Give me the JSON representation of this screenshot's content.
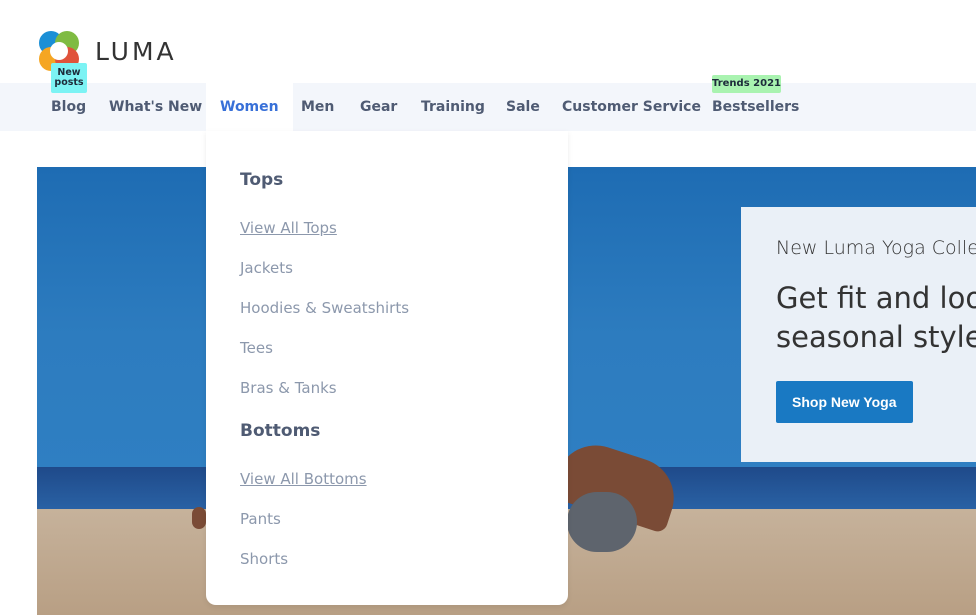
{
  "brand": {
    "name": "LUMA"
  },
  "colors": {
    "nav_bg": "#f3f6fb",
    "accent": "#3870d8",
    "button": "#1979c3",
    "badge_new": "#7cf3f4",
    "badge_trends": "#a9f3b0"
  },
  "nav": {
    "items": [
      {
        "label": "Blog",
        "active": false
      },
      {
        "label": "What's New",
        "active": false
      },
      {
        "label": "Women",
        "active": true
      },
      {
        "label": "Men",
        "active": false
      },
      {
        "label": "Gear",
        "active": false
      },
      {
        "label": "Training",
        "active": false
      },
      {
        "label": "Sale",
        "active": false
      },
      {
        "label": "Customer Service",
        "active": false
      },
      {
        "label": "Bestsellers",
        "active": false
      }
    ],
    "badges": {
      "blog": "New posts",
      "bestsellers": "Trends 2021"
    }
  },
  "dropdown": {
    "tops": {
      "heading": "Tops",
      "links": [
        "View All Tops",
        "Jackets",
        "Hoodies & Sweatshirts",
        "Tees",
        "Bras & Tanks"
      ]
    },
    "bottoms": {
      "heading": "Bottoms",
      "links": [
        "View All Bottoms",
        "Pants",
        "Shorts"
      ]
    }
  },
  "promo": {
    "kicker": "New Luma Yoga Collection",
    "title_line1": "Get fit and look fab in new",
    "title_line2": "seasonal styles",
    "button": "Shop New Yoga"
  }
}
